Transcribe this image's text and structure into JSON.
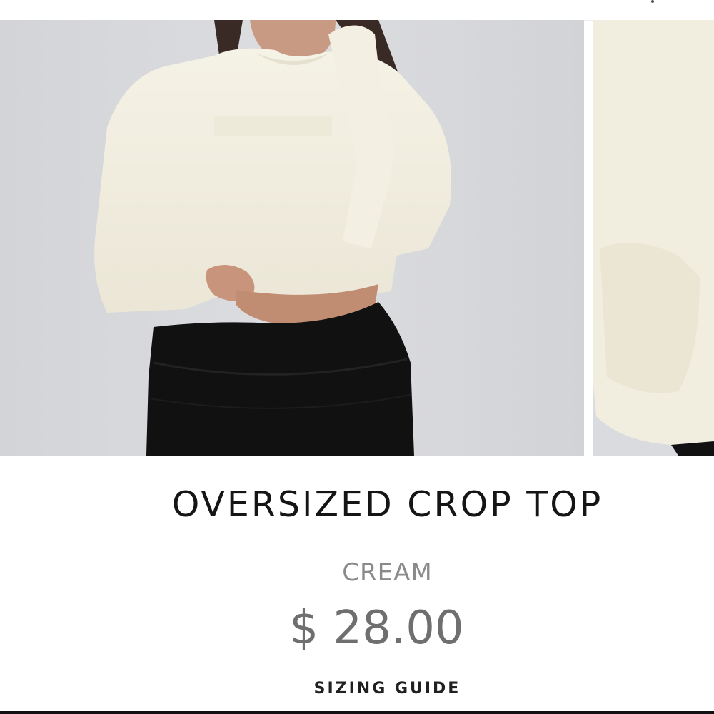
{
  "product": {
    "title": "OVERSIZED CROP TOP",
    "color": "CREAM",
    "price": "$ 28.00",
    "sizing_guide_label": "SIZING GUIDE"
  },
  "gallery": {
    "images": [
      {
        "name": "product-image-front"
      },
      {
        "name": "product-image-side"
      }
    ]
  },
  "colors": {
    "title": "#151515",
    "color_label": "#8a8a8a",
    "price": "#6f6f6f",
    "backdrop": "#d8d9db",
    "garment": "#f2efe2",
    "leggings": "#111111"
  }
}
